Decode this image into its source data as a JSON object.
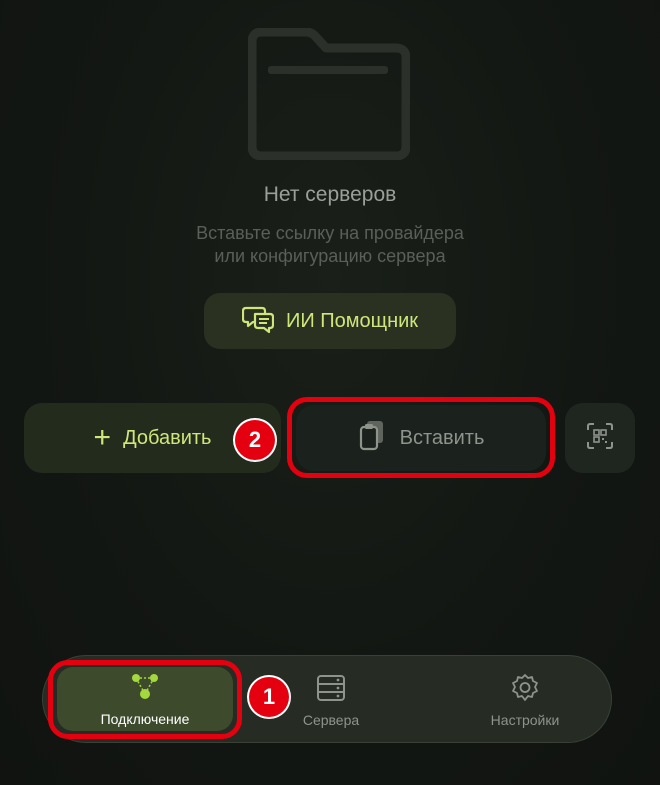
{
  "empty_state": {
    "icon": "folder-icon",
    "title": "Нет серверов",
    "subtitle_line1": "Вставьте ссылку на провайдера",
    "subtitle_line2": "или конфигурацию сервера"
  },
  "ai_button": {
    "label": "ИИ Помощник",
    "icon": "chat-bubbles-icon"
  },
  "actions": {
    "add_label": "Добавить",
    "add_icon_glyph": "+",
    "paste_label": "Вставить",
    "paste_icon": "clipboard-icon",
    "qr_icon": "qr-scan-icon"
  },
  "annotations": {
    "badge_1": "1",
    "badge_2": "2",
    "highlight_color": "#e5000f"
  },
  "nav": {
    "items": [
      {
        "label": "Подключение",
        "icon": "connection-nodes-icon",
        "active": true
      },
      {
        "label": "Сервера",
        "icon": "server-stack-icon",
        "active": false
      },
      {
        "label": "Настройки",
        "icon": "gear-icon",
        "active": false
      }
    ]
  },
  "colors": {
    "accent": "#cfe67a",
    "accent_bright": "#a3d93c",
    "background": "#131713"
  }
}
